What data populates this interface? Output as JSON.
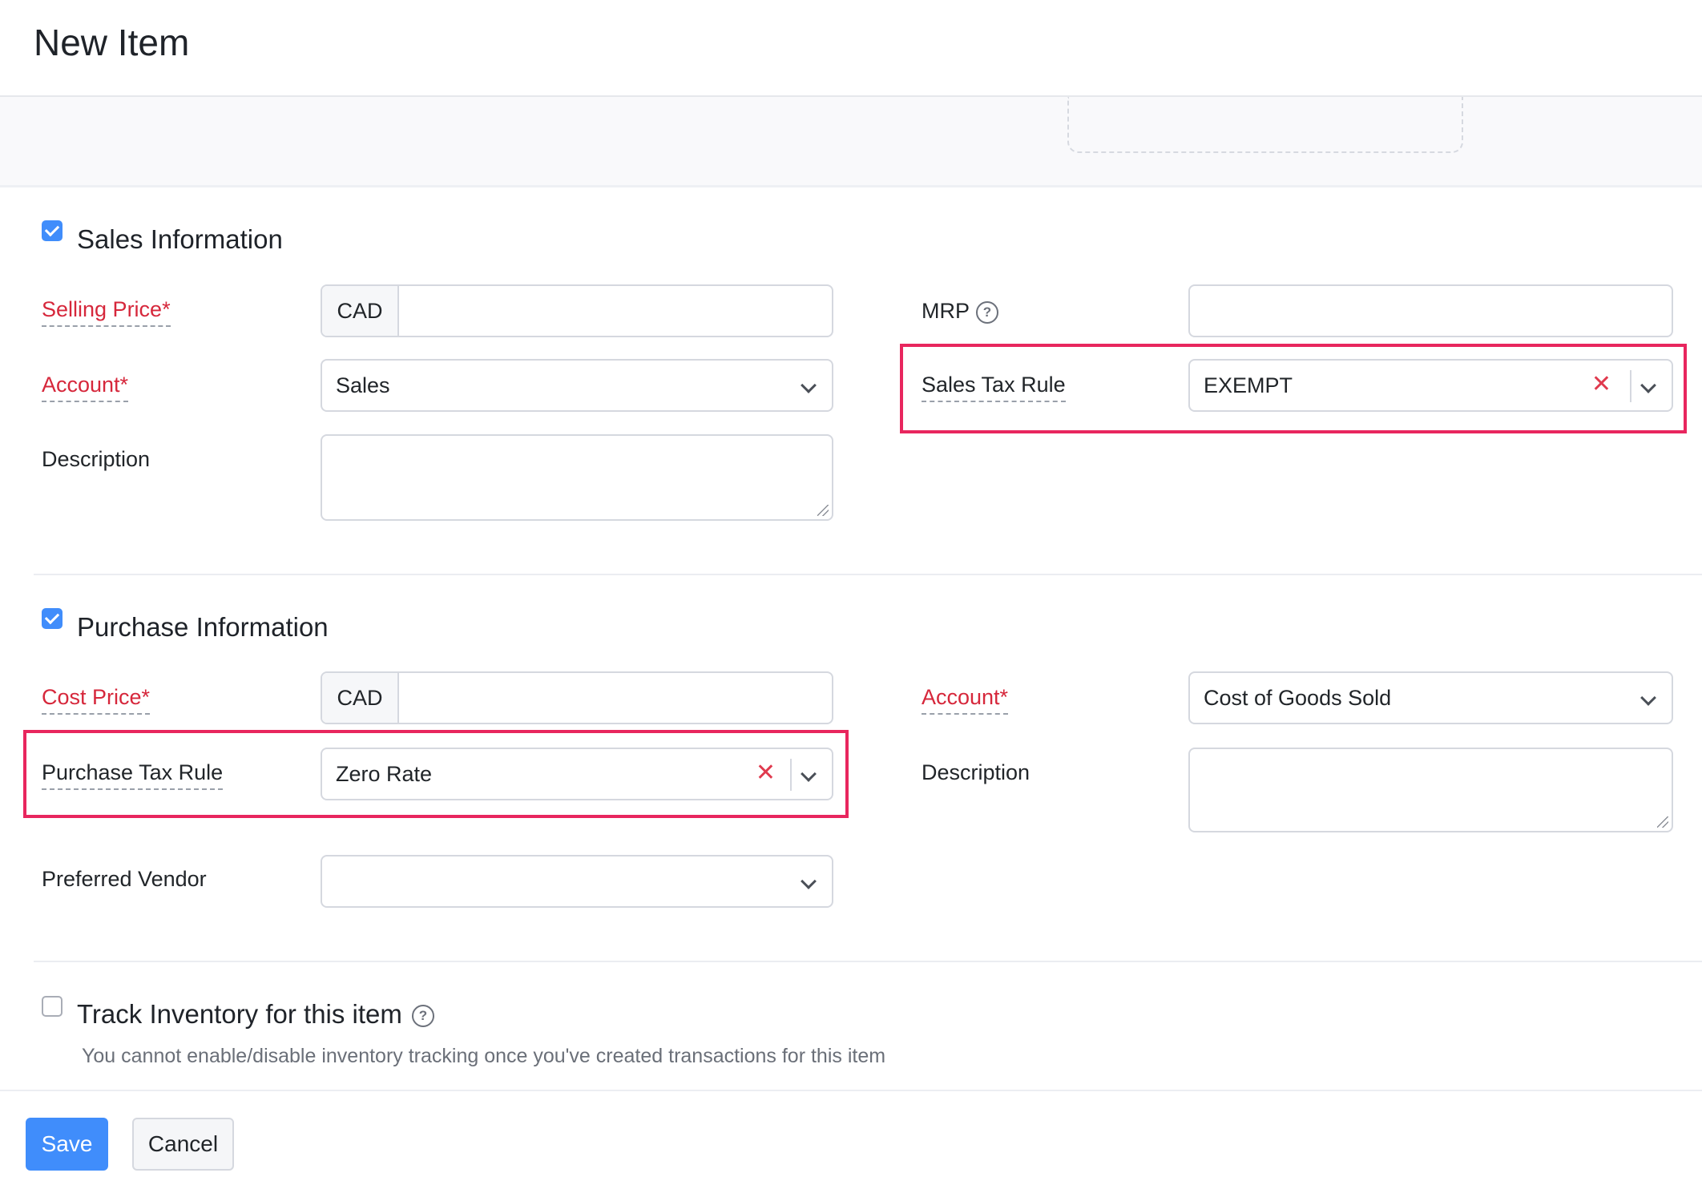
{
  "header": {
    "title": "New Item"
  },
  "sales": {
    "title": "Sales Information",
    "checked": true,
    "selling_price_label": "Selling Price*",
    "currency": "CAD",
    "selling_price_value": "",
    "account_label": "Account*",
    "account_value": "Sales",
    "description_label": "Description",
    "mrp_label": "MRP",
    "mrp_value": "",
    "tax_rule_label": "Sales Tax Rule",
    "tax_rule_value": "EXEMPT"
  },
  "purchase": {
    "title": "Purchase Information",
    "checked": true,
    "cost_price_label": "Cost Price*",
    "currency": "CAD",
    "cost_price_value": "",
    "tax_rule_label": "Purchase Tax Rule",
    "tax_rule_value": "Zero Rate",
    "preferred_vendor_label": "Preferred Vendor",
    "preferred_vendor_value": "",
    "account_label": "Account*",
    "account_value": "Cost of Goods Sold",
    "description_label": "Description"
  },
  "inventory": {
    "title": "Track Inventory for this item",
    "checked": false,
    "hint": "You cannot enable/disable inventory tracking once you've created transactions for this item"
  },
  "footer": {
    "save_label": "Save",
    "cancel_label": "Cancel"
  },
  "icons": {
    "help": "?",
    "clear": "✕"
  },
  "colors": {
    "accent": "#408dfb",
    "required": "#d6273b",
    "highlight": "#e8265e"
  }
}
